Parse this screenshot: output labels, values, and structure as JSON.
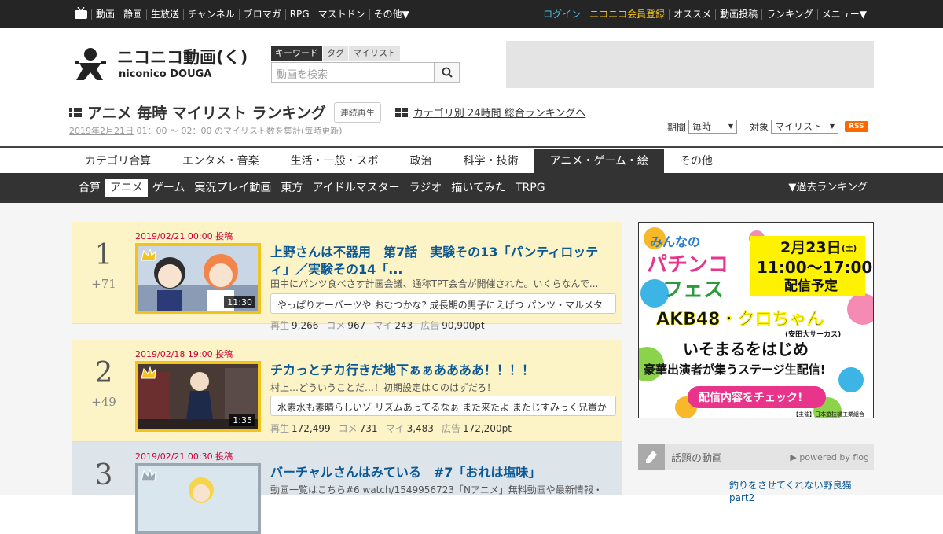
{
  "topbar": {
    "left_items": [
      "動画",
      "静画",
      "生放送",
      "チャンネル",
      "ブロマガ",
      "RPG",
      "マストドン",
      "その他▼"
    ],
    "right_items": [
      {
        "label": "ログイン",
        "color": "#4cc2e8"
      },
      {
        "label": "ニコニコ会員登録",
        "color": "#f2c31a"
      },
      {
        "label": "オススメ",
        "color": "#ffffff"
      },
      {
        "label": "動画投稿",
        "color": "#ffffff"
      },
      {
        "label": "ランキング",
        "color": "#ffffff"
      },
      {
        "label": "メニュー▼",
        "color": "#ffffff"
      }
    ]
  },
  "logo": {
    "line1": "ニコニコ動画(く)",
    "line2": "niconico DOUGA"
  },
  "search": {
    "tabs": [
      "キーワード",
      "タグ",
      "マイリスト"
    ],
    "placeholder": "動画を検索"
  },
  "page": {
    "title": "アニメ 毎時 マイリスト ランキング",
    "continuous_play": "連続再生",
    "category_link": "カテゴリ別 24時間 総合ランキングへ",
    "date": "2019年2月21日",
    "period_text": " 01：00 ～ 02：00 のマイリスト数を集計(毎時更新)"
  },
  "filters": {
    "period_label": "期間",
    "period_value": "毎時",
    "target_label": "対象",
    "target_value": "マイリスト",
    "rss": "RSS"
  },
  "category_tabs": [
    "カテゴリ合算",
    "エンタメ・音楽",
    "生活・一般・スポ",
    "政治",
    "科学・技術",
    "アニメ・ゲーム・絵",
    "その他"
  ],
  "sub_tabs": [
    "合算",
    "アニメ",
    "ゲーム",
    "実況プレイ動画",
    "東方",
    "アイドルマスター",
    "ラジオ",
    "描いてみた",
    "TRPG"
  ],
  "past_ranking": "▼過去ランキング",
  "labels": {
    "views": "再生",
    "comments": "コメ",
    "mylists": "マイ",
    "ads": "広告"
  },
  "rankings": [
    {
      "rank": "1",
      "diff": "+71",
      "date": "2019/02/21 00:00 投稿",
      "title": "上野さんは不器用　第7話　実験その13「パンティロッティ」／実験その14「...",
      "desc": "田中にパンツ食べさす計画会議、通称TPT会合が開催された。いくらなんで...",
      "comment": "やっぱりオーバーツや おむつかな? 成長期の男子にえげつ パンツ・マルメタ",
      "duration": "11:30",
      "views": "9,266",
      "comments": "967",
      "mylists": "243",
      "ads": "90,900pt"
    },
    {
      "rank": "2",
      "diff": "+49",
      "date": "2019/02/18 19:00 投稿",
      "title": "チカっとチカ行きだ地下ぁぁああああ！！！！",
      "desc": "村上…どういうことだ…！初期設定はＣのはずだろ！",
      "comment": "水素水も素晴らしいゾ リズムあってるなぁ また来たよ またじすみっく兄貴か",
      "duration": "1:35",
      "views": "172,499",
      "comments": "731",
      "mylists": "3,483",
      "ads": "172,200pt"
    },
    {
      "rank": "3",
      "diff": "",
      "date": "2019/02/21 00:30 投稿",
      "title": "バーチャルさんはみている　#7「おれは塩味」",
      "desc": "動画一覧はこちら#6 watch/1549956723「Nアニメ」無料動画や最新情報・...",
      "comment": "",
      "duration": "",
      "views": "",
      "comments": "",
      "mylists": "",
      "ads": ""
    }
  ],
  "ad": {
    "line1": "みんなの",
    "line2": "パチンコ",
    "line3": "フェス",
    "date": "2月23日",
    "day": "(土)",
    "time": "11:00〜17:00",
    "status": "配信予定",
    "headline": "AKB48・クロちゃん",
    "sub": "(安田大サーカス)",
    "headline2": "いそまるをはじめ",
    "headline3": "豪華出演者が集うステージ生配信!",
    "cta": "配信内容をチェック!",
    "sponsor": "【主催】日本遊技機工業組合"
  },
  "topic": {
    "label": "話題の動画",
    "powered": "▶ powered by flog",
    "item": "釣りをさせてくれない野良猫part2"
  }
}
